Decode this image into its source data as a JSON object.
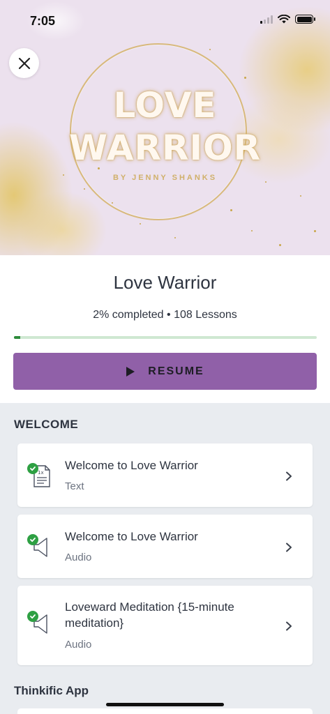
{
  "status_bar": {
    "time": "7:05"
  },
  "hero": {
    "title_line1": "LOVE",
    "title_line2": "WARRIOR",
    "byline": "BY JENNY SHANKS"
  },
  "course": {
    "title": "Love Warrior",
    "progress_text": "2% completed • 108 Lessons",
    "progress_fraction": 0.02,
    "resume_label": "RESUME"
  },
  "sections": [
    {
      "title": "WELCOME",
      "lessons": [
        {
          "title": "Welcome to Love Warrior",
          "type": "Text",
          "icon": "text-document-icon",
          "completed": true
        },
        {
          "title": "Welcome to Love Warrior",
          "type": "Audio",
          "icon": "audio-speaker-icon",
          "completed": true
        },
        {
          "title": "Loveward Meditation {15-minute meditation}",
          "type": "Audio",
          "icon": "audio-speaker-icon",
          "completed": true
        }
      ]
    },
    {
      "title": "Thinkific App",
      "lessons": []
    }
  ],
  "colors": {
    "accent": "#9060a8",
    "progress": "#2e8b3c",
    "check": "#2ea043"
  }
}
